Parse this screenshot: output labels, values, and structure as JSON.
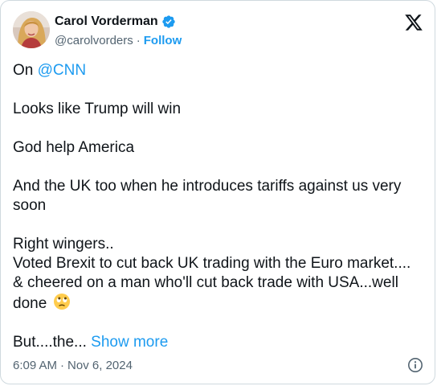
{
  "author": {
    "display_name": "Carol Vorderman",
    "handle": "@carolvorders",
    "follow_label": "Follow",
    "separator": "·",
    "verified": true
  },
  "tweet": {
    "p1_prefix": "On ",
    "p1_mention": "@CNN",
    "p2": "Looks like Trump will win",
    "p3": "God help America",
    "p4": "And the UK too when he introduces tariffs against us very soon",
    "p5_line1": "Right wingers..",
    "p5_line2": "Voted Brexit to cut back UK trading with the Euro market....",
    "p5_line3": "& cheered on a man who'll cut back trade with USA...well done",
    "p6_prefix": "But....the...",
    "show_more": "Show more"
  },
  "footer": {
    "time": "6:09 AM",
    "separator": "·",
    "date": "Nov 6, 2024"
  },
  "icons": {
    "verified": "verified-badge-icon",
    "x_logo": "x-logo-icon",
    "emoji": "eye-roll-emoji-icon",
    "info": "info-icon"
  },
  "colors": {
    "link": "#1d9bf0",
    "text": "#0f1419",
    "secondary": "#536471",
    "border": "#cfd9de"
  }
}
